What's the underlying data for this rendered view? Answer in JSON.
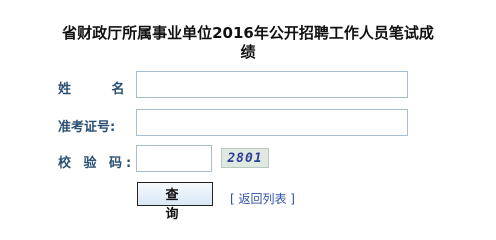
{
  "page": {
    "title": "省财政厅所属事业单位2016年公开招聘工作人员笔试成绩"
  },
  "form": {
    "name_label": "姓 名:",
    "name_value": "",
    "id_label": "准考证号:",
    "id_value": "",
    "captcha_label": "校 验 码:",
    "captcha_value": "",
    "captcha_image_text": "2801",
    "submit_label": "查 询",
    "back_link_label": "[ 返回列表 ]"
  }
}
